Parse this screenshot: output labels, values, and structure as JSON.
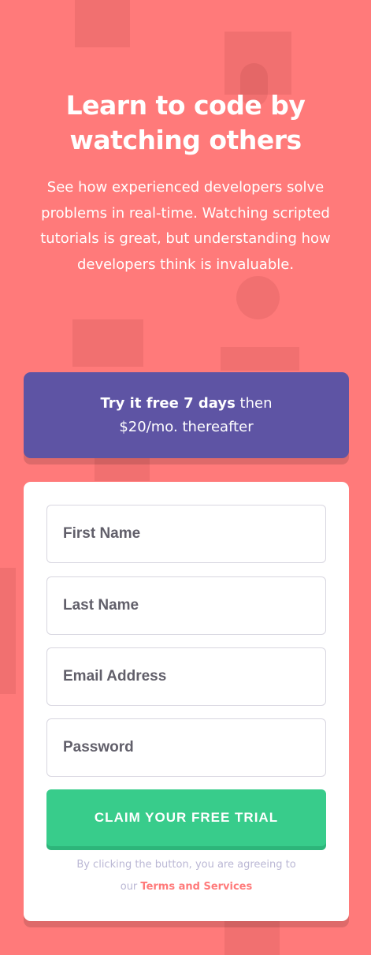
{
  "hero": {
    "title": "Learn to code by watching others",
    "description": "See how experienced developers solve problems in real-time. Watching scripted tutorials is great, but understanding how developers think is invaluable."
  },
  "promo": {
    "bold": "Try it free 7 days",
    "rest_line1": " then",
    "rest_line2": "$20/mo. thereafter"
  },
  "form": {
    "first_name": {
      "placeholder": "First Name",
      "value": ""
    },
    "last_name": {
      "placeholder": "Last Name",
      "value": ""
    },
    "email": {
      "placeholder": "Email Address",
      "value": ""
    },
    "password": {
      "placeholder": "Password",
      "value": ""
    },
    "submit_label": "CLAIM YOUR FREE TRIAL",
    "terms_prefix": "By clicking the button, you are agreeing to",
    "terms_our": "our",
    "terms_link": "Terms and Services"
  },
  "colors": {
    "background": "#ff7a7a",
    "promo": "#5e54a4",
    "cta": "#38cc8b",
    "link": "#ff7a7a"
  }
}
